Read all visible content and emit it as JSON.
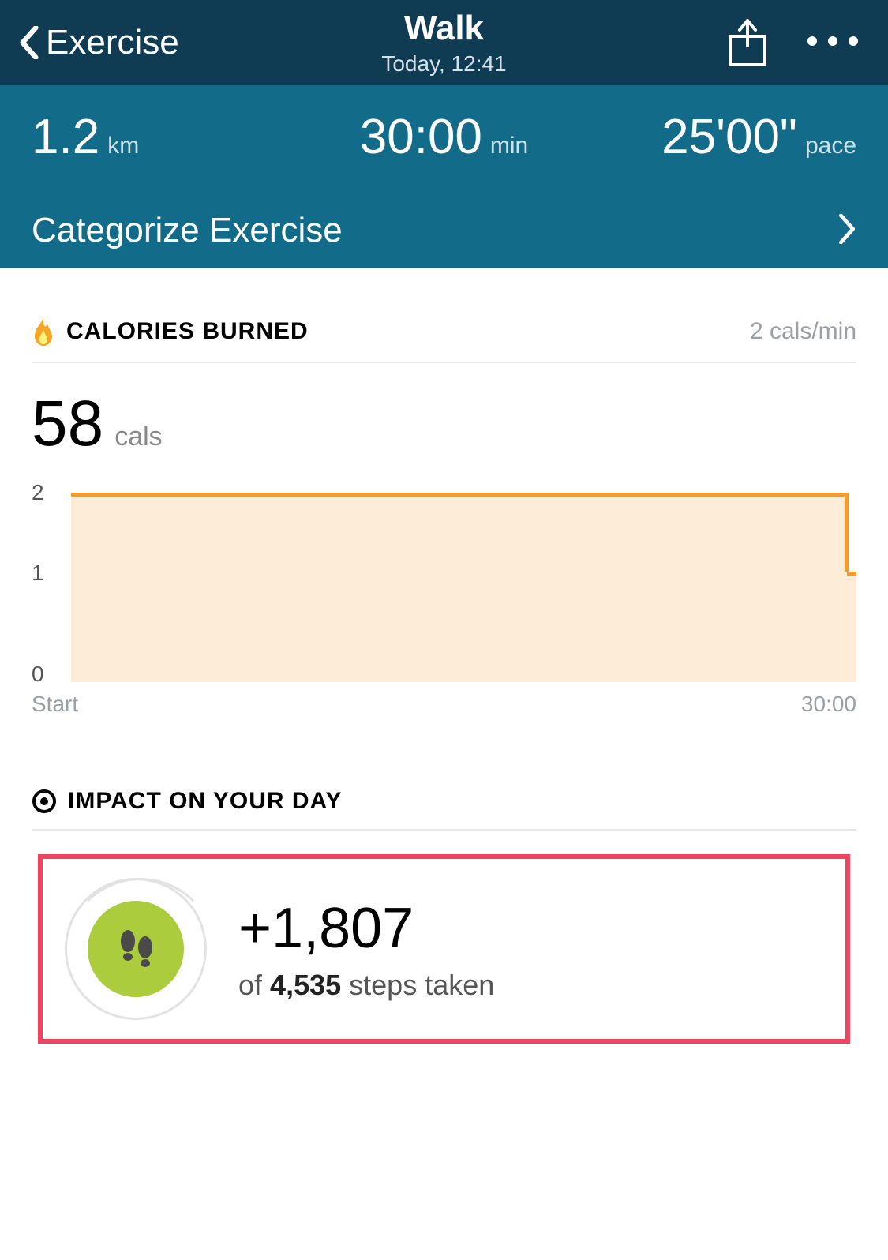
{
  "header": {
    "back_label": "Exercise",
    "title": "Walk",
    "subtitle": "Today, 12:41"
  },
  "stats": {
    "distance_value": "1.2",
    "distance_unit": "km",
    "duration_value": "30:00",
    "duration_unit": "min",
    "pace_value": "25'00\"",
    "pace_unit": "pace",
    "categorize_label": "Categorize Exercise"
  },
  "calories": {
    "section_title": "CALORIES BURNED",
    "rate": "2 cals/min",
    "total_value": "58",
    "total_unit": "cals"
  },
  "chart_data": {
    "type": "area",
    "title": "",
    "xlabel": "",
    "ylabel": "",
    "x": [
      "Start",
      "30:00"
    ],
    "y_ticks": [
      "0",
      "1",
      "2"
    ],
    "ylim": [
      0,
      2
    ],
    "series": [
      {
        "name": "cals/min",
        "values_approx": "≈2 for entire duration, drops to ≈1 at 30:00"
      }
    ],
    "x_start_label": "Start",
    "x_end_label": "30:00"
  },
  "impact": {
    "section_title": "IMPACT ON YOUR DAY",
    "steps_added": "+1,807",
    "of_word": "of",
    "total_steps": "4,535",
    "suffix": "steps taken"
  }
}
